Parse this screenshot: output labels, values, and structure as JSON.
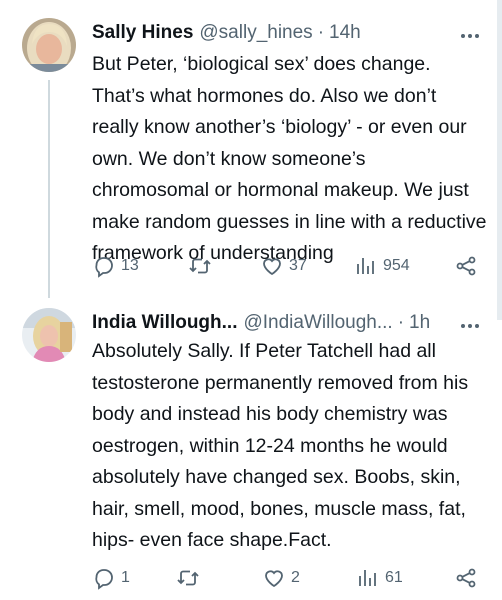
{
  "tweets": [
    {
      "author_name": "Sally Hines",
      "handle": "@sally_hines",
      "separator": "·",
      "time": "14h",
      "text": "But Peter, ‘biological sex’ does change. That’s what hormones do. Also we don’t really know another’s ‘biology’ - or even our own. We don’t know someone’s chromosomal or hormonal makeup. We just make random guesses in line with a reductive framework of understanding",
      "replies": "13",
      "retweets": "",
      "likes": "37",
      "views": "954"
    },
    {
      "author_name": "India Willough...",
      "handle": "@IndiaWillough...",
      "separator": "·",
      "time": "1h",
      "text": "Absolutely Sally. If Peter Tatchell had all testosterone permanently removed from his body and instead his body chemistry was oestrogen, within 12-24 months he would  absolutely have changed sex. Boobs, skin, hair, smell, mood, bones, muscle mass, fat, hips- even face shape.Fact.",
      "replies": "1",
      "retweets": "",
      "likes": "2",
      "views": "61"
    }
  ],
  "icons": {
    "reply": "reply-icon",
    "retweet": "retweet-icon",
    "like": "heart-icon",
    "views": "views-icon",
    "share": "share-icon",
    "more": "more-icon"
  },
  "colors": {
    "text": "#0f1419",
    "secondary": "#536471",
    "thread_line": "#cfd9de"
  }
}
